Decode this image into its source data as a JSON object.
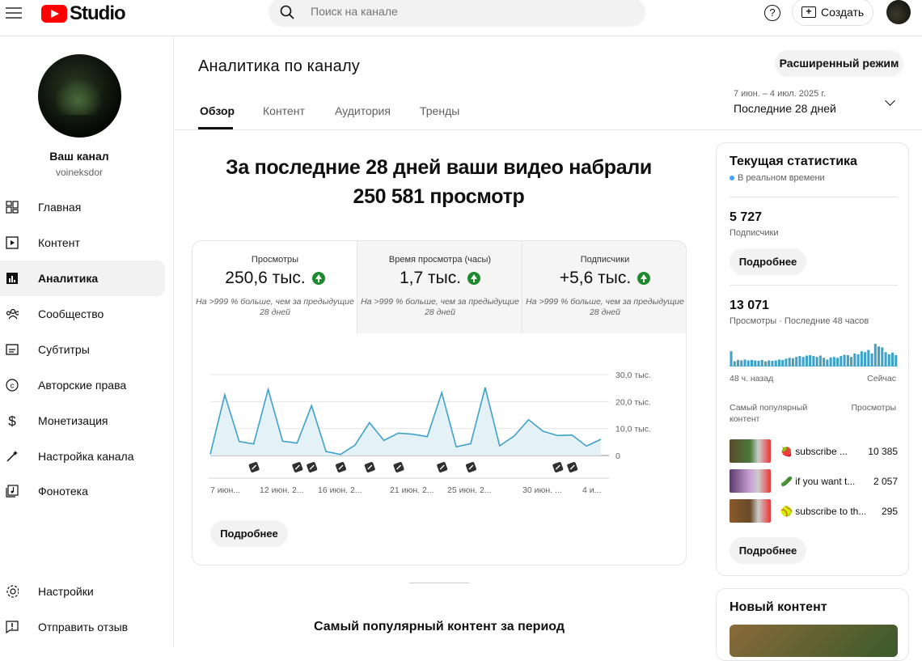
{
  "header": {
    "logo_text": "Studio",
    "search_placeholder": "Поиск на канале",
    "help_label": "?",
    "create_label": "Создать"
  },
  "sidebar": {
    "channel_name": "Ваш канал",
    "channel_handle": "voineksdor",
    "items": [
      {
        "label": "Главная",
        "icon": "dashboard-icon"
      },
      {
        "label": "Контент",
        "icon": "content-icon"
      },
      {
        "label": "Аналитика",
        "icon": "analytics-icon",
        "active": true
      },
      {
        "label": "Сообщество",
        "icon": "community-icon"
      },
      {
        "label": "Субтитры",
        "icon": "subtitles-icon"
      },
      {
        "label": "Авторские права",
        "icon": "copyright-icon"
      },
      {
        "label": "Монетизация",
        "icon": "monetization-icon"
      },
      {
        "label": "Настройка канала",
        "icon": "customization-icon"
      },
      {
        "label": "Фонотека",
        "icon": "audio-library-icon"
      }
    ],
    "bottom_items": [
      {
        "label": "Настройки",
        "icon": "settings-icon"
      },
      {
        "label": "Отправить отзыв",
        "icon": "feedback-icon"
      }
    ]
  },
  "main": {
    "title": "Аналитика по каналу",
    "advanced_mode": "Расширенный режим",
    "tabs": [
      "Обзор",
      "Контент",
      "Аудитория",
      "Тренды"
    ],
    "date_range": "7 июн. – 4 июл. 2025 г.",
    "period": "Последние 28 дней",
    "headline_line1": "За последние 28 дней ваши видео набрали",
    "headline_line2": "250 581 просмотр",
    "metrics": [
      {
        "label": "Просмотры",
        "value": "250,6 тыс.",
        "note": "На >999 % больше, чем за предыдущие 28 дней"
      },
      {
        "label": "Время просмотра (часы)",
        "value": "1,7 тыс.",
        "note": "На >999 % больше, чем за предыдущие 28 дней"
      },
      {
        "label": "Подписчики",
        "value": "+5,6 тыс.",
        "note": "На >999 % больше, чем за предыдущие 28 дней"
      }
    ],
    "more_button": "Подробнее",
    "popular_title": "Самый популярный контент за период"
  },
  "chart_data": {
    "type": "area",
    "x": [
      "7 июн.",
      "8 июн.",
      "9 июн.",
      "10 июн.",
      "11 июн.",
      "12 июн.",
      "13 июн.",
      "14 июн.",
      "15 июн.",
      "16 июн.",
      "17 июн.",
      "18 июн.",
      "19 июн.",
      "20 июн.",
      "21 июн.",
      "22 июн.",
      "23 июн.",
      "24 июн.",
      "25 июн.",
      "26 июн.",
      "27 июн.",
      "28 июн.",
      "29 июн.",
      "30 июн.",
      "1 июл.",
      "2 июл.",
      "3 июл.",
      "4 июл."
    ],
    "values": [
      500,
      22500,
      5200,
      4300,
      24500,
      5300,
      4600,
      18500,
      1500,
      400,
      3800,
      12200,
      5600,
      8300,
      7900,
      7000,
      23300,
      3200,
      4400,
      25200,
      3600,
      7200,
      13300,
      9000,
      7400,
      7600,
      3500,
      6000
    ],
    "x_tick_labels": [
      "7 июн...",
      "12 июн. 2...",
      "16 июн. 2...",
      "21 июн. 2...",
      "25 июн. 2...",
      "30 июн. ...",
      "4 и..."
    ],
    "y_tick_labels": [
      "30,0 тыс.",
      "20,0 тыс.",
      "10,0 тыс.",
      "0"
    ],
    "ylim": [
      0,
      30000
    ],
    "video_markers": 14,
    "colors": {
      "line": "#3ea1c9",
      "fill": "#e4f2f8"
    }
  },
  "realtime": {
    "title": "Текущая статистика",
    "live": "В реальном времени",
    "subscribers": "5 727",
    "subscribers_label": "Подписчики",
    "more": "Подробнее",
    "views": "13 071",
    "views_label": "Просмотры · Последние 48 часов",
    "bars_start": "48 ч. назад",
    "bars_end": "Сейчас",
    "bars": [
      35,
      12,
      15,
      14,
      16,
      14,
      15,
      14,
      13,
      15,
      12,
      14,
      13,
      14,
      16,
      15,
      18,
      20,
      19,
      22,
      24,
      22,
      25,
      26,
      24,
      22,
      25,
      20,
      16,
      21,
      22,
      20,
      24,
      27,
      26,
      22,
      30,
      28,
      35,
      33,
      38,
      30,
      52,
      46,
      44,
      33,
      28,
      32,
      26
    ],
    "top_content_label": "Самый популярный контент",
    "views_col": "Просмотры",
    "top": [
      {
        "emoji": "🍓",
        "title": "subscribe ...",
        "views": "10 385"
      },
      {
        "emoji": "🥒",
        "title": "if you want t...",
        "views": "2 057"
      },
      {
        "emoji": "🥎",
        "title": "subscribe to th...",
        "views": "295"
      }
    ],
    "more2": "Подробнее"
  },
  "new_content": {
    "title": "Новый контент"
  }
}
